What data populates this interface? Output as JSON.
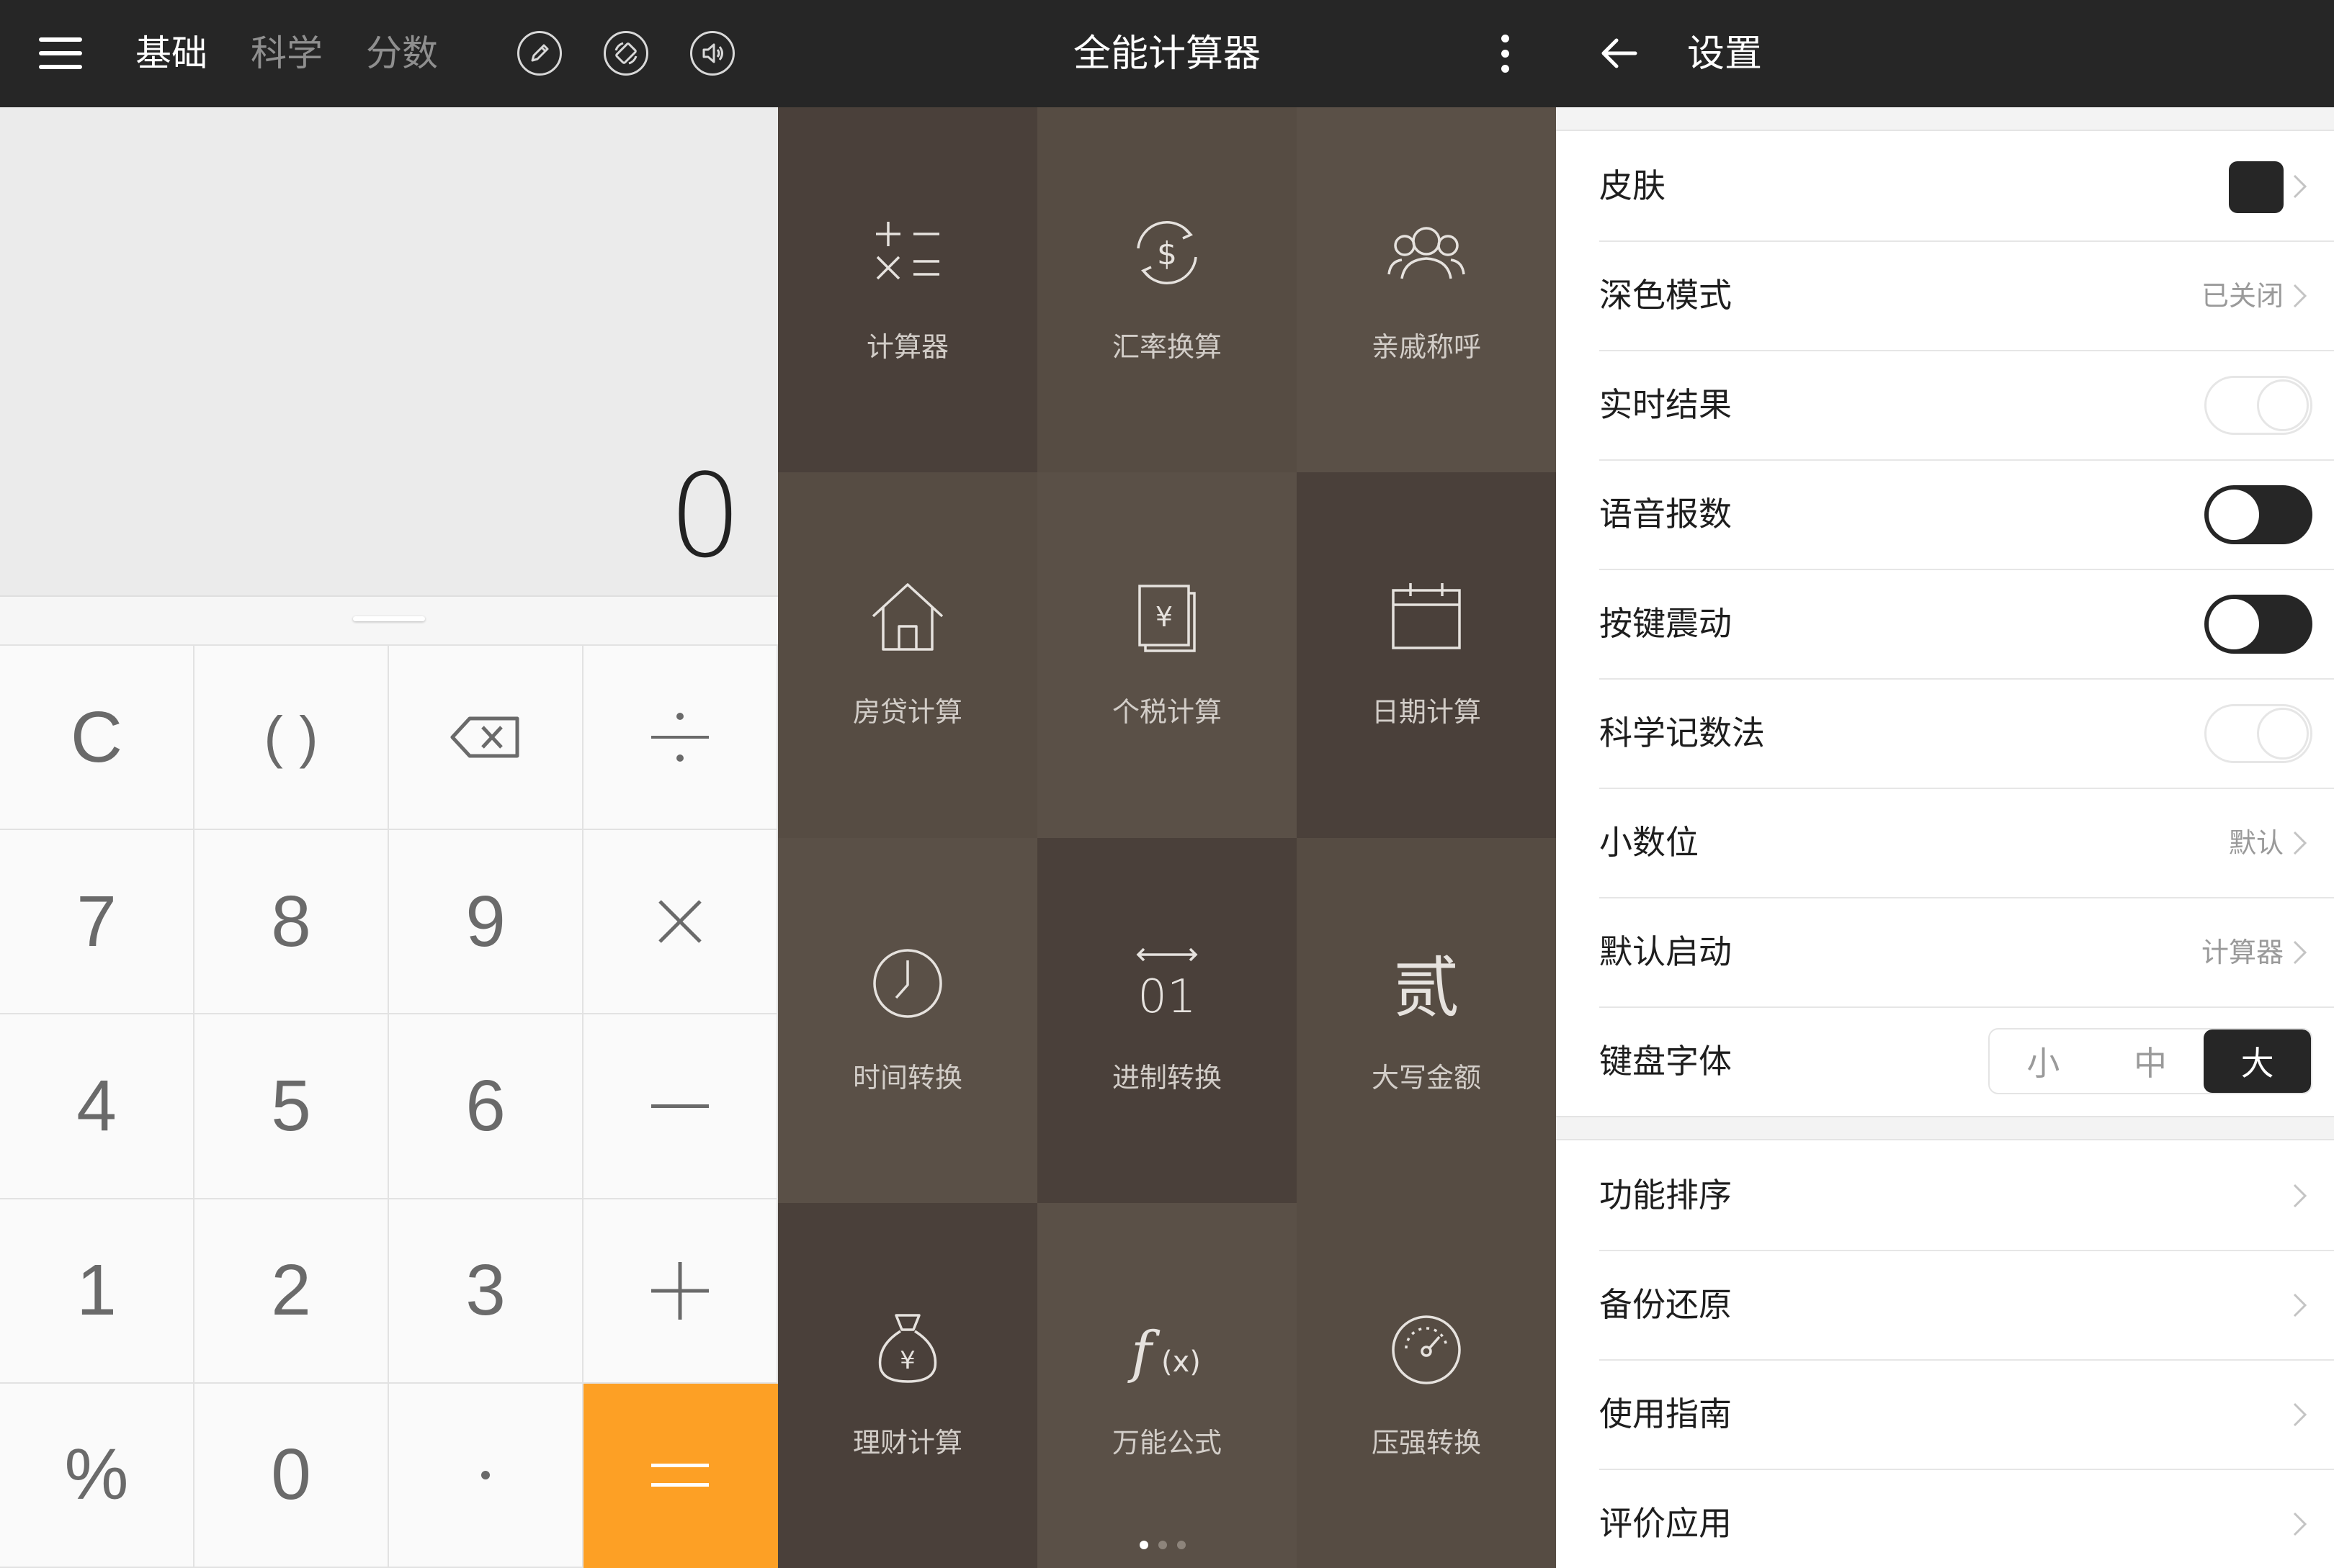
{
  "calculator": {
    "tabs": [
      "基础",
      "科学",
      "分数"
    ],
    "active_tab": "基础",
    "toolbar_icons": [
      "edit-icon",
      "rotate-icon",
      "sound-icon"
    ],
    "display_value": "0",
    "keys": {
      "clear": "C",
      "parens": "( )",
      "seven": "7",
      "eight": "8",
      "nine": "9",
      "four": "4",
      "five": "5",
      "six": "6",
      "one": "1",
      "two": "2",
      "three": "3",
      "percent": "%",
      "zero": "0"
    },
    "colors": {
      "accent": "#fda025",
      "bar": "#262626",
      "display_bg": "#ebebeb"
    }
  },
  "tools": {
    "title": "全能计算器",
    "tiles": [
      {
        "label": "计算器",
        "icon": "calculator-ops-icon"
      },
      {
        "label": "汇率换算",
        "icon": "exchange-rate-icon"
      },
      {
        "label": "亲戚称呼",
        "icon": "relatives-icon"
      },
      {
        "label": "房贷计算",
        "icon": "house-icon"
      },
      {
        "label": "个税计算",
        "icon": "tax-document-icon"
      },
      {
        "label": "日期计算",
        "icon": "calendar-icon"
      },
      {
        "label": "时间转换",
        "icon": "clock-icon"
      },
      {
        "label": "进制转换",
        "icon": "binary-icon"
      },
      {
        "label": "大写金额",
        "icon": "chinese-numeral-icon"
      },
      {
        "label": "理财计算",
        "icon": "money-bag-icon"
      },
      {
        "label": "万能公式",
        "icon": "function-icon"
      },
      {
        "label": "压强转换",
        "icon": "gauge-icon"
      }
    ],
    "page_count": 3,
    "current_page": 1,
    "colors": {
      "tile_dark": "#4a403a",
      "tile_mid": "#564c43",
      "tile_light": "#5a5047"
    }
  },
  "settings": {
    "title": "设置",
    "rows": {
      "skin": "皮肤",
      "dark_mode": "深色模式",
      "dark_mode_value": "已关闭",
      "realtime": "实时结果",
      "realtime_on": false,
      "voice": "语音报数",
      "voice_on": true,
      "vibrate": "按键震动",
      "vibrate_on": true,
      "scientific": "科学记数法",
      "scientific_on": false,
      "decimals": "小数位",
      "decimals_value": "默认",
      "default_start": "默认启动",
      "default_start_value": "计算器",
      "key_font": "键盘字体",
      "font_options": [
        "小",
        "中",
        "大"
      ],
      "font_selected": "大"
    },
    "more": {
      "sort": "功能排序",
      "backup": "备份还原",
      "guide": "使用指南",
      "rate": "评价应用"
    },
    "colors": {
      "skin_swatch": "#262626"
    }
  }
}
